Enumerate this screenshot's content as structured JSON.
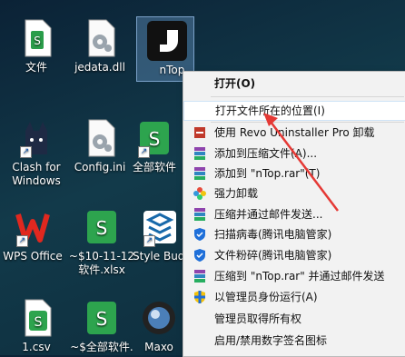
{
  "desktop": {
    "icons": [
      {
        "name": "file-folder-icon",
        "label": "文件",
        "kind": "doc"
      },
      {
        "name": "dll-file-icon",
        "label": "jedata.dll",
        "kind": "gear"
      },
      {
        "name": "ntop-app-icon",
        "label": "nTop..",
        "kind": "ntop"
      },
      {
        "name": "clash-app-icon",
        "label": "Clash for Windows",
        "kind": "clash"
      },
      {
        "name": "ini-file-icon",
        "label": "Config.ini",
        "kind": "gear"
      },
      {
        "name": "wps-sheet-shortcut-icon",
        "label": "全部软件",
        "kind": "sheet"
      },
      {
        "name": "wps-office-icon",
        "label": "WPS Office",
        "kind": "wps"
      },
      {
        "name": "xlsx-file-icon",
        "label": "~$10-11-12 软件.xlsx",
        "kind": "sheet"
      },
      {
        "name": "style-buddy-icon",
        "label": "Style Budd",
        "kind": "stack"
      },
      {
        "name": "csv-file-icon",
        "label": "1.csv",
        "kind": "sheet"
      },
      {
        "name": "temp-sheet-icon",
        "label": "~$全部软件.",
        "kind": "sheet"
      },
      {
        "name": "maxon-app-icon",
        "label": "Maxo",
        "kind": "cinema"
      }
    ]
  },
  "context_menu": {
    "items": [
      {
        "name": "menu-open",
        "label": "打开(O)",
        "bold": true,
        "icon": ""
      },
      {
        "name": "menu-open-location",
        "label": "打开文件所在的位置(I)",
        "hover": true,
        "icon": ""
      },
      {
        "name": "menu-revo-uninstall",
        "label": "使用 Revo Uninstaller Pro 卸载",
        "icon": "revo"
      },
      {
        "name": "menu-add-archive",
        "label": "添加到压缩文件(A)...",
        "icon": "rar"
      },
      {
        "name": "menu-add-ntop-rar",
        "label": "添加到 \"nTop.rar\"(T)",
        "icon": "rar"
      },
      {
        "name": "menu-force-uninstall",
        "label": "强力卸载",
        "icon": "flower"
      },
      {
        "name": "menu-compress-email",
        "label": "压缩并通过邮件发送...",
        "icon": "rar"
      },
      {
        "name": "menu-scan-virus",
        "label": "扫描病毒(腾讯电脑管家)",
        "icon": "shield"
      },
      {
        "name": "menu-shred-file",
        "label": "文件粉碎(腾讯电脑管家)",
        "icon": "shield"
      },
      {
        "name": "menu-compress-ntop-email",
        "label": "压缩到 \"nTop.rar\" 并通过邮件发送",
        "icon": "rar"
      },
      {
        "name": "menu-run-as-admin",
        "label": "以管理员身份运行(A)",
        "icon": "uac"
      },
      {
        "name": "menu-take-ownership",
        "label": "管理员取得所有权",
        "icon": ""
      },
      {
        "name": "menu-digital-signature",
        "label": "启用/禁用数字签名图标",
        "icon": ""
      }
    ]
  },
  "colors": {
    "arrow": "#e53935",
    "hover_border": "#cfe3f6"
  }
}
